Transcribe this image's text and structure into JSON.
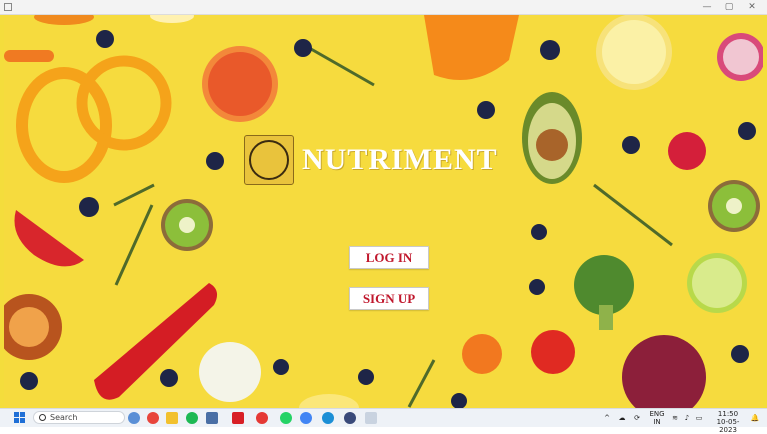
{
  "window": {
    "minimize_glyph": "—",
    "maximize_glyph": "▢",
    "close_glyph": "✕"
  },
  "app": {
    "brand_name": "NUTRIMENT",
    "logo_icon": "nutriment-logo-icon",
    "login_label": "LOG IN",
    "signup_label": "SIGN UP",
    "background_color": "#f6db3e",
    "button_text_color": "#c0182d"
  },
  "taskbar": {
    "search_placeholder": "Search",
    "language": "ENG",
    "region": "IN",
    "time": "11:50",
    "date": "10-05-2023",
    "pinned_icons": [
      "copilot-icon",
      "chrome-icon",
      "file-explorer-icon",
      "spotify-icon",
      "calculator-icon",
      "netflix-icon",
      "record-icon",
      "whatsapp-icon",
      "chrome-profile-icon",
      "edge-icon",
      "app-icon",
      "python-app-icon"
    ]
  }
}
